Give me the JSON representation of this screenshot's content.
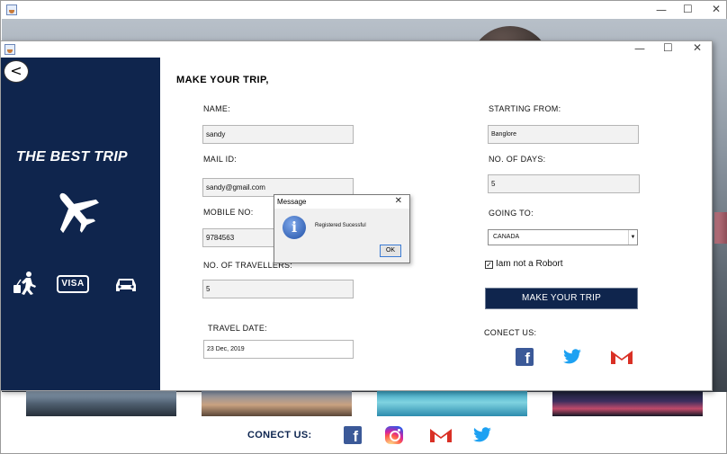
{
  "back_window": {
    "controls": {
      "minimize": "—",
      "maximize": "☐",
      "close": "✕"
    },
    "connect_label": "CONECT US:",
    "social": [
      "facebook-icon",
      "instagram-icon",
      "gmail-icon",
      "twitter-icon"
    ]
  },
  "front_window": {
    "controls": {
      "minimize": "—",
      "maximize": "☐",
      "close": "✕"
    },
    "sidebar": {
      "back_symbol": "<",
      "brand": "THE BEST TRIP",
      "icons": [
        "airplane-icon",
        "traveler-icon",
        "visa-icon",
        "car-icon"
      ],
      "visa_text": "VISA"
    },
    "heading": "MAKE YOUR TRIP,",
    "form": {
      "name_label": "NAME:",
      "name_value": "sandy",
      "mail_label": "MAIL ID:",
      "mail_value": "sandy@gmail.com",
      "mobile_label": "MOBILE NO:",
      "mobile_value": "9784563",
      "travellers_label": "NO. OF TRAVELLERS:",
      "travellers_value": "5",
      "date_label": "TRAVEL DATE:",
      "date_value": "23 Dec, 2019",
      "from_label": "STARTING FROM:",
      "from_value": "Banglore",
      "days_label": "NO. OF DAYS:",
      "days_value": "5",
      "going_label": "GOING TO:",
      "going_value": "CANADA",
      "robot_label": "Iam not a Robort",
      "robot_checked": true,
      "submit_label": "MAKE YOUR TRIP",
      "connect_label": "CONECT US:"
    }
  },
  "dialog": {
    "title": "Message",
    "close": "✕",
    "icon": "info-icon",
    "message": "Registered Sucessful",
    "ok_label": "OK"
  },
  "colors": {
    "navy": "#0f254d",
    "facebook": "#3b5998",
    "twitter": "#1da1f2",
    "gmail_red": "#d93025"
  }
}
